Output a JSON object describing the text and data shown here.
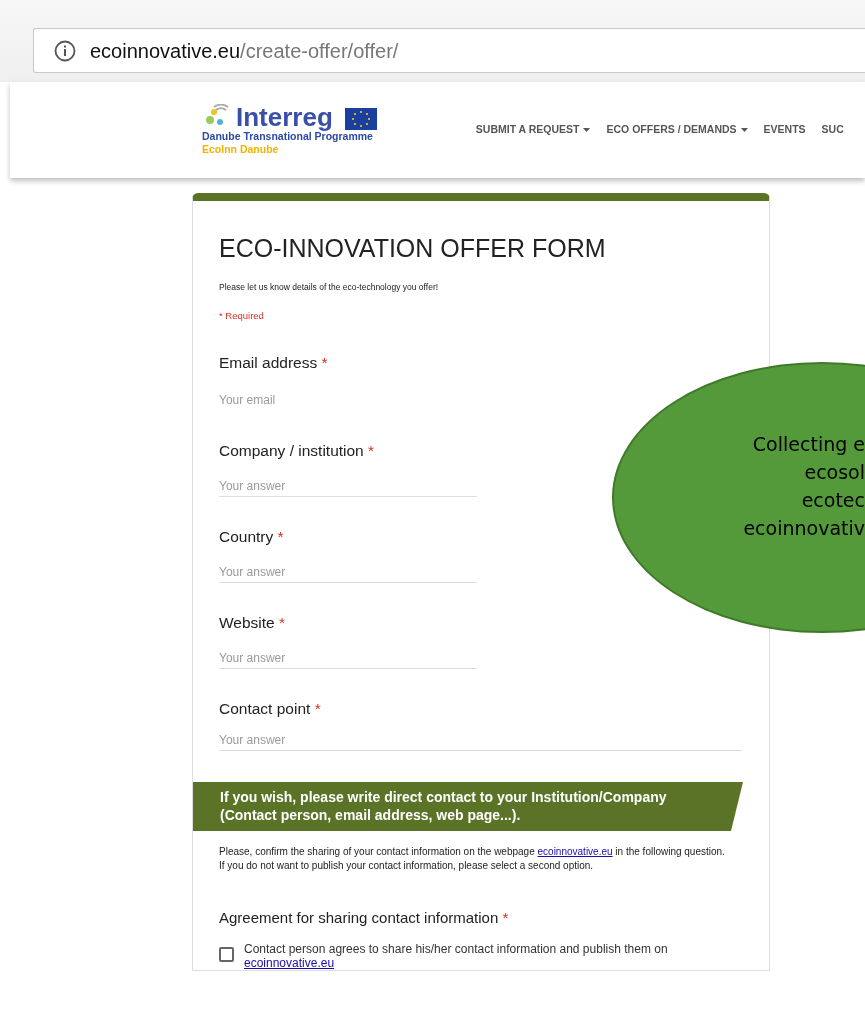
{
  "browser": {
    "url_domain": "ecoinnovative.eu",
    "url_path": "/create-offer/offer/"
  },
  "header": {
    "logo": {
      "name": "Interreg",
      "subtitle": "Danube Transnational Programme",
      "project": "EcoInn Danube"
    },
    "nav": [
      {
        "label": "SUBMIT A REQUEST",
        "dropdown": true
      },
      {
        "label": "ECO OFFERS / DEMANDS",
        "dropdown": true
      },
      {
        "label": "EVENTS",
        "dropdown": false
      },
      {
        "label": "SUC",
        "dropdown": false
      }
    ]
  },
  "form": {
    "title": "ECO-INNOVATION OFFER FORM",
    "description": "Please let us know details of the eco-technology you offer!",
    "required_note": "* Required",
    "questions": [
      {
        "label": "Email address",
        "required_mark": "*",
        "placeholder": "Your email",
        "kind": "email"
      },
      {
        "label": "Company / institution",
        "required_mark": "*",
        "placeholder": "Your answer",
        "kind": "short"
      },
      {
        "label": "Country",
        "required_mark": "*",
        "placeholder": "Your answer",
        "kind": "short"
      },
      {
        "label": "Website",
        "required_mark": "*",
        "placeholder": "Your answer",
        "kind": "short"
      },
      {
        "label": "Contact point",
        "required_mark": "*",
        "placeholder": "Your answer",
        "kind": "long"
      }
    ],
    "section": {
      "title": "If you wish, please write direct contact to your Institution/Company (Contact person, email address, web page...).",
      "description_before": "Please, confirm the sharing of your contact information on the webpage ",
      "description_link": "ecoinnovative.eu",
      "description_after": " in the following question.",
      "description_second": "If you do not want to publish your contact information, please select a second option."
    },
    "agreement": {
      "label": "Agreement for sharing contact information",
      "required_mark": "*",
      "options": [
        {
          "label": "Contact person agrees to share his/her contact information and publish them on ",
          "link": "ecoinnovative.eu",
          "checked": false
        }
      ]
    }
  },
  "overlay": {
    "lines": [
      "Collecting e",
      "ecosol",
      "ecotec",
      "ecoinnovativ"
    ]
  }
}
